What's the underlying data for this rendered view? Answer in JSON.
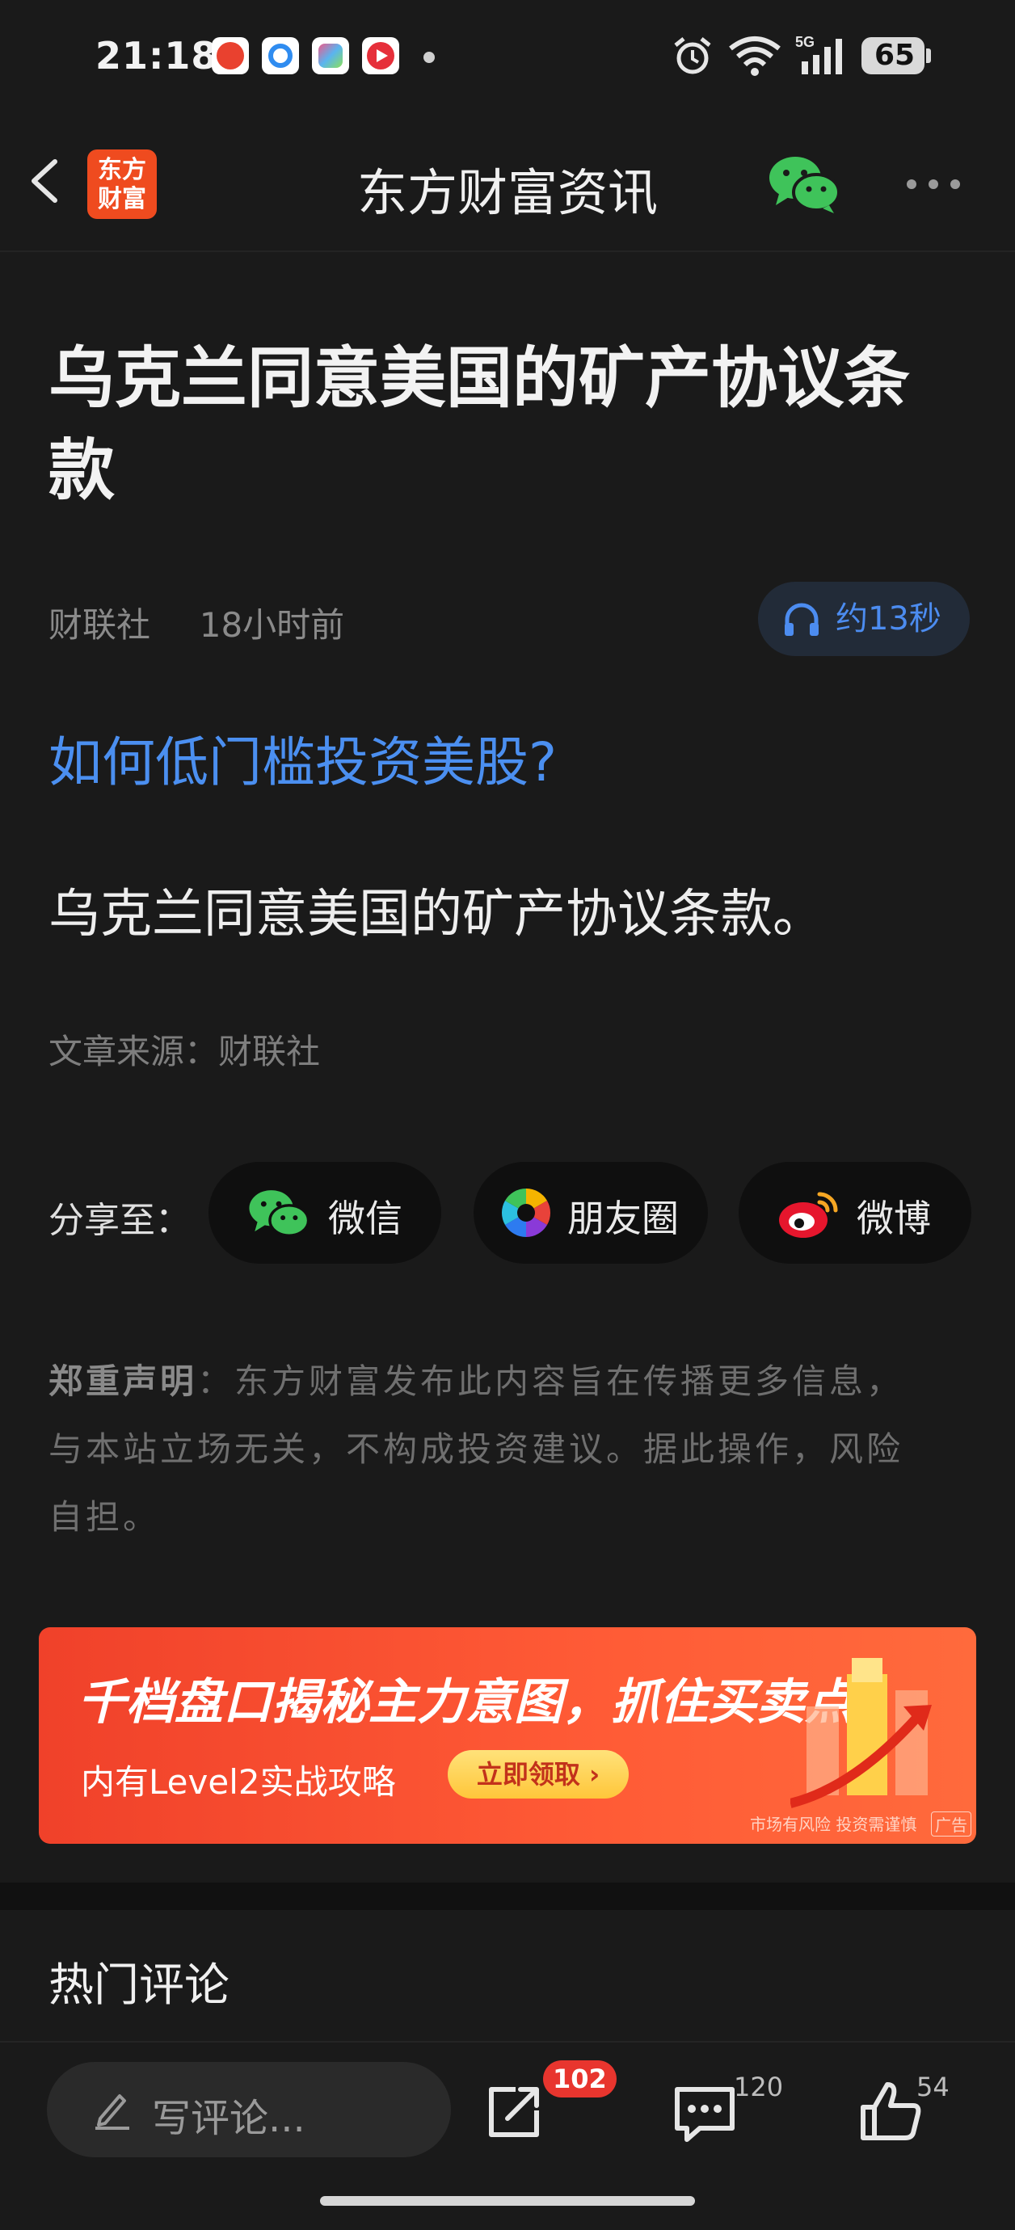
{
  "status_bar": {
    "time": "21:18",
    "battery": "65"
  },
  "header": {
    "title": "东方财富资讯",
    "logo_text_line1": "东方",
    "logo_text_line2": "财富"
  },
  "article": {
    "title": "乌克兰同意美国的矿产协议条款",
    "source_name": "财联社",
    "time_ago": "18小时前",
    "listen_label": "约13秒",
    "promo_link": "如何低门槛投资美股?",
    "body": "乌克兰同意美国的矿产协议条款。",
    "source_line": "文章来源：财联社"
  },
  "share": {
    "label": "分享至：",
    "items": [
      {
        "label": "微信",
        "icon": "wechat-icon"
      },
      {
        "label": "朋友圈",
        "icon": "moments-icon"
      },
      {
        "label": "微博",
        "icon": "weibo-icon"
      }
    ]
  },
  "disclaimer": {
    "heading": "郑重声明",
    "text": "：东方财富发布此内容旨在传播更多信息，与本站立场无关，不构成投资建议。据此操作，风险自担。"
  },
  "banner": {
    "title": "千档盘口揭秘主力意图，抓住买卖点",
    "subtitle": "内有Level2实战攻略",
    "cta": "立即领取 ›",
    "risk_note": "市场有风险 投资需谨慎",
    "ad_tag": "广告"
  },
  "comments": {
    "title": "热门评论"
  },
  "bottom_bar": {
    "comment_placeholder": "写评论...",
    "share_count": "102",
    "comment_count": "120",
    "like_count": "54"
  },
  "colors": {
    "accent_blue": "#4b8ff0",
    "brand_orange": "#ef4b1f",
    "badge_red": "#e8352e"
  }
}
